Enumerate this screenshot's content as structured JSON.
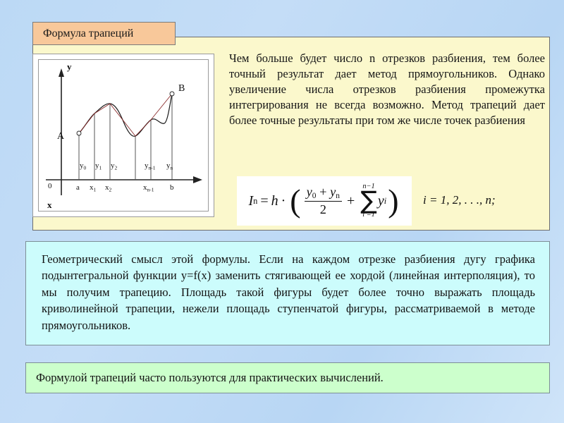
{
  "slide": {
    "title": "Формула трапеций",
    "background_colors": {
      "slide_gradient_from": "#bcd9f5",
      "slide_gradient_to": "#cfe4f9",
      "title_tab": "#f8c89a",
      "yellow_panel": "#fbf8cc",
      "cyan_panel": "#ccfcfc",
      "green_panel": "#ccffcc"
    }
  },
  "intro_paragraph": "Чем больше будет число n отрезков разбиения, тем более точный результат дает метод прямоугольников. Однако увеличение числа отрезков разбиения промежутка интегрирования не всегда возможно. Метод трапеций дает более точные результаты при том же числе точек разбиения",
  "formula": {
    "lhs": "I",
    "lhs_sub": "n",
    "equals": "=",
    "h": "h",
    "dot": "·",
    "numerator_left": "y",
    "numerator_left_sub": "0",
    "plus": "+",
    "numerator_right": "y",
    "numerator_right_sub": "n",
    "denominator": "2",
    "sum_upper": "n−1",
    "sum_symbol": "∑",
    "sum_lower": "i =1",
    "sum_term": "y",
    "sum_term_sub": "i",
    "note": "i = 1, 2, . . ., n;"
  },
  "graph": {
    "axis_y_label": "y",
    "axis_x_label": "x",
    "origin_label": "0",
    "point_a_label": "A",
    "point_b_label": "B",
    "x_ticks": [
      "a",
      "x",
      "x",
      "x",
      "b"
    ],
    "x_tick_texts": [
      {
        "base": "a",
        "sub": ""
      },
      {
        "base": "x",
        "sub": "1"
      },
      {
        "base": "x",
        "sub": "2"
      },
      {
        "base": "x",
        "sub": "n-1"
      },
      {
        "base": "b",
        "sub": ""
      }
    ],
    "y_ordinate_texts": [
      {
        "base": "y",
        "sub": "0"
      },
      {
        "base": "y",
        "sub": "1"
      },
      {
        "base": "y",
        "sub": "2"
      },
      {
        "base": "y",
        "sub": "n-1"
      },
      {
        "base": "y",
        "sub": "n"
      }
    ]
  },
  "geometric_meaning": "Геометрический смысл этой формулы. Если на каждом отрезке разбиения дугу графика подынтегральной функции y=f(x) заменить стягивающей ее хордой (линейная интерполяция), то мы получим трапецию. Площадь такой фигуры будет более точно выражать площадь криволинейной трапеции, нежели площадь ступенчатой фигуры, рассматриваемой в методе прямоугольников.",
  "practical_note": "Формулой трапеций часто пользуются для практических вычислений."
}
